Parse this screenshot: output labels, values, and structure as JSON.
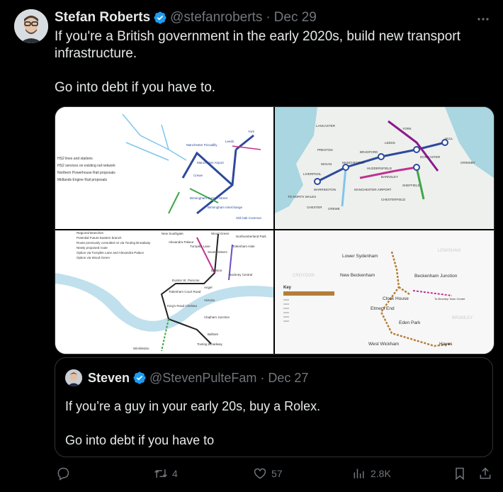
{
  "tweet": {
    "author_name": "Stefan Roberts",
    "handle": "@stefanroberts",
    "separator": "·",
    "date": "Dec 29",
    "text": "If you're a British government in the early 2020s, build new transport infrastructure.\n\nGo into debt if you have to."
  },
  "media": {
    "panel1": {
      "legend": [
        "HS2 lines and stations",
        "HS2 services on existing rail network",
        "Northern Powerhouse Rail proposals",
        "Midlands Engine Rail proposals"
      ],
      "labels": [
        "Manchester Piccadilly",
        "Manchester Airport",
        "Leeds",
        "Birmingham Curzon Street",
        "Birmingham Interchange",
        "Old Oak Common",
        "Crewe",
        "York"
      ]
    },
    "panel2": {
      "labels": [
        "LANCASTER",
        "PRESTON",
        "WIGAN",
        "LIVERPOOL",
        "WARRINGTON",
        "MANCHESTER",
        "MANCHESTER AIRPORT",
        "HUDDERSFIELD",
        "BRADFORD",
        "LEEDS",
        "YORK",
        "HULL",
        "DONCASTER",
        "SHEFFIELD",
        "BARNSLEY",
        "CHESTERFIELD",
        "CHESTER",
        "CREWE",
        "GRIMSBY",
        "TO NORTH WALES"
      ]
    },
    "panel3": {
      "legend": [
        "Regional Branches",
        "Potential Future Eastern branch",
        "Route previously consulted on via Tooting Broadway",
        "Newly proposed route",
        "Option via Turnpike Lane and Alexandra Palace",
        "Option via Wood Green"
      ],
      "labels": [
        "New Southgate",
        "Wood Green",
        "Northumberland Park",
        "Alexandra Palace",
        "Turnpike Lane",
        "Tottenham Hale",
        "Seven Sisters",
        "Hackney Central",
        "Dalston",
        "Euston St. Pancras",
        "Angel",
        "Tottenham Court Road",
        "Victoria",
        "King's Road Chelsea",
        "Clapham Junction",
        "Balham",
        "Tooting Broadway",
        "Wimbledon"
      ]
    },
    "panel4": {
      "labels": [
        "LEWISHAM",
        "CROYDON",
        "BROMLEY",
        "Lower Sydenham",
        "New Beckenham",
        "Beckenham Junction",
        "Clock House",
        "Elmers End",
        "Eden Park",
        "West Wickham",
        "Hayes",
        "To Bromley Town Centre"
      ],
      "key_title": "Key"
    }
  },
  "quote": {
    "author_name": "Steven",
    "handle": "@StevenPulteFam",
    "separator": "·",
    "date": "Dec 27",
    "text": "If you’re a guy in your early 20s, buy a Rolex.\n\nGo into debt if you have to"
  },
  "actions": {
    "reply_count": "",
    "retweet_count": "4",
    "like_count": "57",
    "view_count": "2.8K"
  },
  "colors": {
    "background": "#000000",
    "text": "#e7e9ea",
    "muted": "#71767b",
    "verified": "#1d9bf0",
    "border": "#2f3336"
  }
}
